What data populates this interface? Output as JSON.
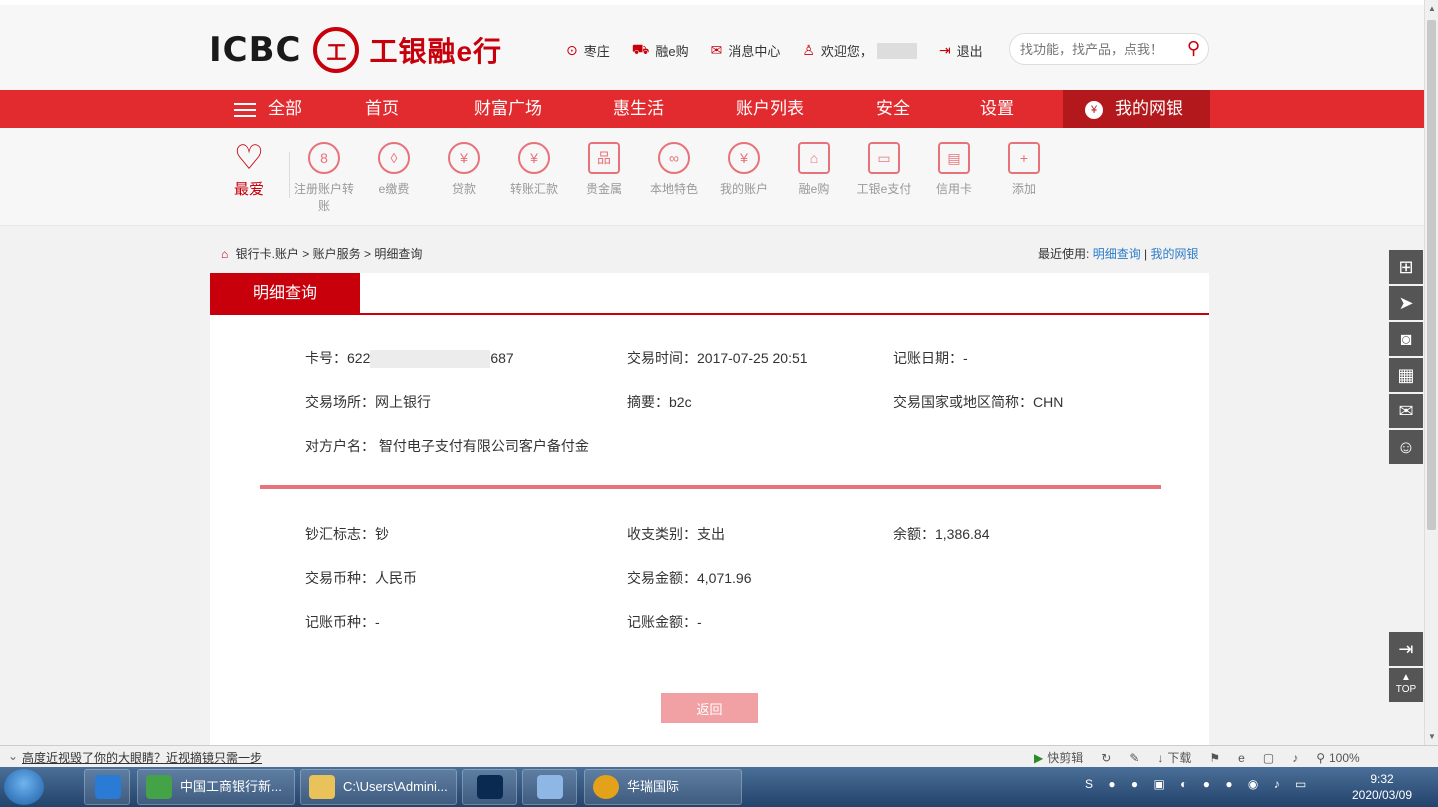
{
  "header": {
    "logo_text": "ICBC",
    "logo_seal": "工",
    "logo_cn": "工银融e行",
    "links": [
      {
        "label": "枣庄",
        "icon": "location-icon"
      },
      {
        "label": "融e购",
        "icon": "cart-icon"
      },
      {
        "label": "消息中心",
        "icon": "mail-icon"
      },
      {
        "label": "欢迎您，",
        "icon": "user-icon"
      },
      {
        "label": "退出",
        "icon": "logout-icon"
      }
    ],
    "search_placeholder": "找功能，找产品，点我！"
  },
  "nav": {
    "items": [
      "全部",
      "首页",
      "财富广场",
      "惠生活",
      "账户列表",
      "安全",
      "设置"
    ],
    "mybank": "我的网银"
  },
  "shortcuts": {
    "favorite": "最爱",
    "items": [
      "注册账户转账",
      "e缴费",
      "贷款",
      "转账汇款",
      "贵金属",
      "本地特色",
      "我的账户",
      "融e购",
      "工银e支付",
      "信用卡",
      "添加"
    ],
    "icons": [
      "8",
      "◊",
      "¥",
      "¥",
      "品",
      "∞",
      "¥",
      "⌂",
      "▭",
      "▤",
      "+"
    ]
  },
  "breadcrumb": {
    "items": [
      "银行卡.账户",
      "账户服务",
      "明细查询"
    ],
    "recent_label": "最近使用:",
    "recent_links": [
      "明细查询",
      "我的网银"
    ]
  },
  "panel": {
    "tab": "明细查询",
    "card_no_label": "卡号：",
    "card_no_prefix": "622",
    "card_no_suffix": "687",
    "trade_time": "交易时间：2017-07-25 20:51",
    "book_date": "记账日期：-",
    "trade_place": "交易场所：网上银行",
    "summary": "摘要：b2c",
    "country": "交易国家或地区简称：CHN",
    "counterparty": "对方户名： 智付电子支付有限公司客户备付金",
    "cash_flag": "钞汇标志：钞",
    "io_type": "收支类别：支出",
    "balance": "余额：1,386.84",
    "currency": "交易币种：人民币",
    "amount": "交易金额：4,071.96",
    "book_currency": "记账币种：-",
    "book_amount": "记账金额：-",
    "back": "返回"
  },
  "right_float": {
    "top_label": "TOP"
  },
  "statusbar": {
    "ad": "高度近视毁了你的大眼睛？近视摘镜只需一步",
    "items": [
      "快剪辑",
      "下载",
      "100%"
    ]
  },
  "taskbar": {
    "windows": [
      "中国工商银行新...",
      "C:\\Users\\Admini...",
      "华瑞国际"
    ],
    "time": "9:32",
    "date": "2020/03/09"
  },
  "colors": {
    "brand_red": "#c7000b",
    "nav_red": "#e22b2f",
    "link_blue": "#2c7cc8"
  }
}
